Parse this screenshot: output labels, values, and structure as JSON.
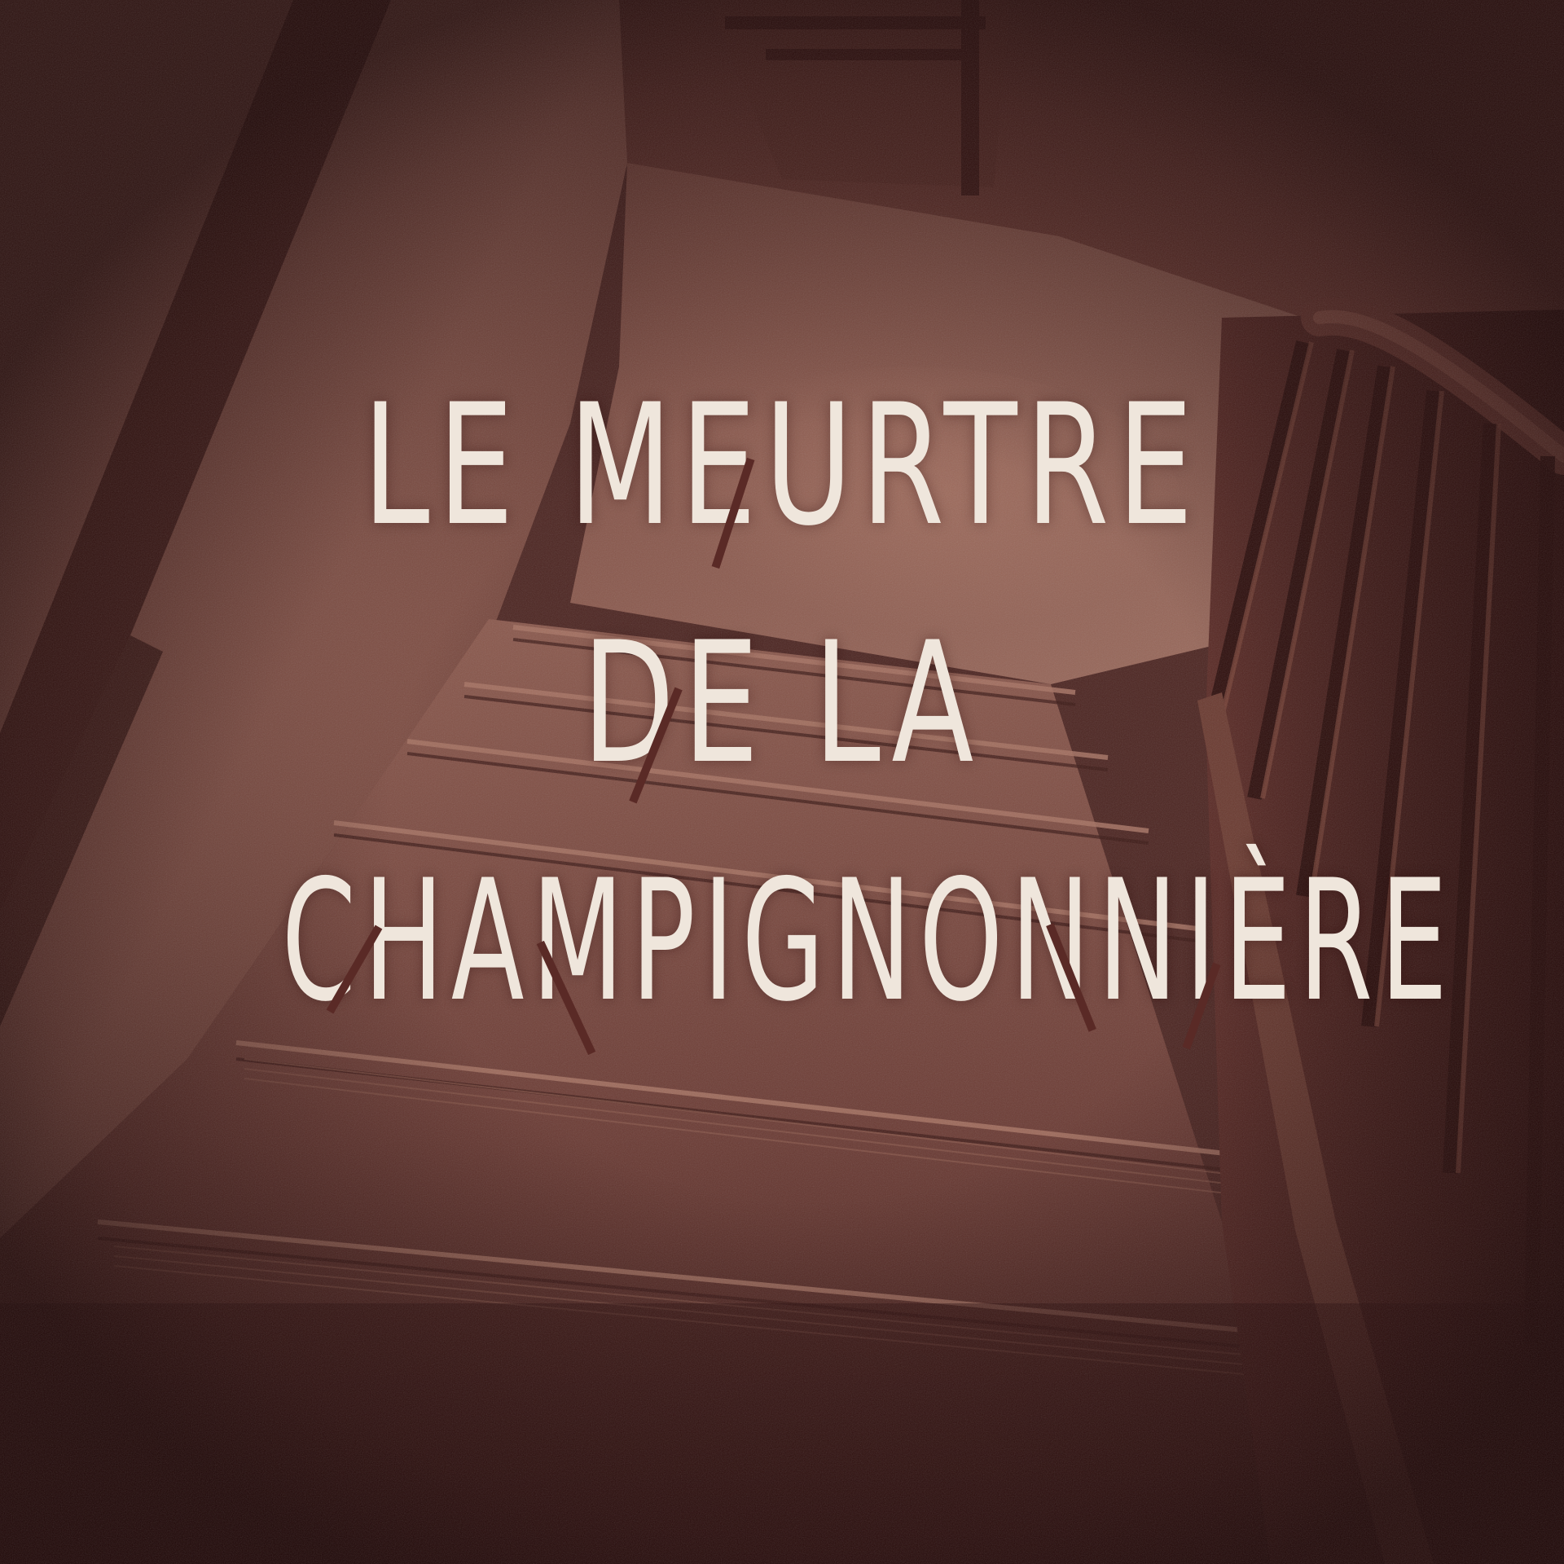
{
  "title": {
    "line1": "LE MEURTRE",
    "line2": "DE LA",
    "line3": "CHAMPIGNONNIÈRE"
  },
  "colors": {
    "title_text": "#efe6dc",
    "tint": "#6b302a",
    "shadow": "#2a0c0a"
  }
}
